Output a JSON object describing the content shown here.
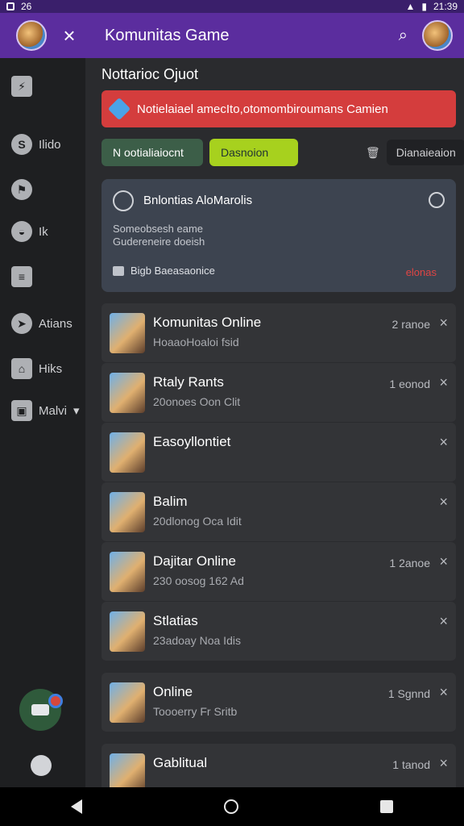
{
  "status": {
    "left_time": "26",
    "right_time": "21:39"
  },
  "appbar": {
    "title": "Komunitas Game"
  },
  "sidebar": {
    "items": [
      {
        "label": "Ilido",
        "icon": "s-icon"
      },
      {
        "label": "",
        "icon": "person-icon"
      },
      {
        "label": "Ik",
        "icon": "hat-icon"
      },
      {
        "label": "",
        "icon": "list-icon"
      },
      {
        "label": "Atians",
        "icon": "send-icon"
      },
      {
        "label": "Hiks",
        "icon": "bank-icon"
      },
      {
        "label": "Malvi",
        "icon": "cd-icon"
      }
    ]
  },
  "main": {
    "section_title": "Nottarioc Ojuot",
    "alert_text": "Notielaiael amecIto,otomombiroumans Camien",
    "chips": {
      "one": "N ootialiaiocnt",
      "two": "Dasnoion",
      "three": "Dianaieaion"
    },
    "card": {
      "name": "Bnlontias AloMarolis",
      "line1": "Someobsesh eame",
      "line2": "Gudereneire doeish",
      "foot": "Bigb Baeasaonice",
      "red": "elonas"
    },
    "rows": [
      {
        "title": "Komunitas Online",
        "subtitle": "HoaaoHoaloi fsid",
        "meta": "2 ranoe"
      },
      {
        "title": "Rtaly Rants",
        "subtitle": "20onoes Oon Clit",
        "meta": "1 eonod"
      },
      {
        "title": "Easoyllontiet",
        "subtitle": "",
        "meta": ""
      },
      {
        "title": "Balim",
        "subtitle": "20dlonog Oca Idit",
        "meta": ""
      },
      {
        "title": "Dajitar Online",
        "subtitle": "230 oosog 162 Ad",
        "meta": "1 2anoe"
      },
      {
        "title": "Stlatias",
        "subtitle": "23adoay Noa Idis",
        "meta": ""
      }
    ],
    "extra_rows": [
      {
        "title": "Online",
        "subtitle": "Toooerry Fr Sritb",
        "meta": "1 Sgnnd"
      },
      {
        "title": "Gablitual",
        "subtitle": "",
        "meta": "1 tanod"
      }
    ]
  },
  "nav": {
    "back_label": "",
    "home_label": "",
    "recents_label": ""
  }
}
